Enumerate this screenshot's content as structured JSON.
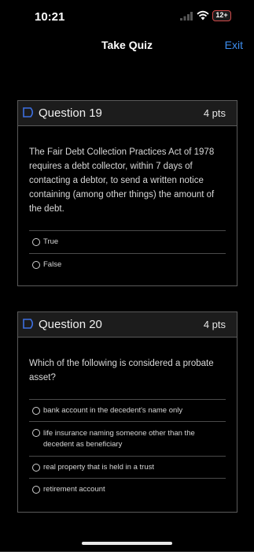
{
  "status": {
    "time": "10:21",
    "battery": "12+"
  },
  "nav": {
    "title": "Take Quiz",
    "exit": "Exit"
  },
  "questions": [
    {
      "title": "Question 19",
      "points": "4 pts",
      "text": "The Fair Debt Collection Practices Act of 1978 requires a debt collector, within 7 days of contacting a debtor, to send a written notice containing (among other things) the amount of the debt.",
      "options": [
        "True",
        "False"
      ]
    },
    {
      "title": "Question 20",
      "points": "4 pts",
      "text": "Which of the following is considered a probate asset?",
      "options": [
        "bank account in the decedent's name only",
        "life insurance naming someone other than the decedent as beneficiary",
        "real property that is held in a trust",
        "retirement account"
      ]
    }
  ],
  "colors": {
    "accent": "#3d8ef0",
    "flag": "#3d6fe0",
    "battery_border": "#d24a4a"
  },
  "icons": {
    "flag": "flag-icon",
    "radio": "radio-unselected-icon",
    "signal": "signal-icon",
    "wifi": "wifi-icon",
    "battery": "battery-icon"
  }
}
